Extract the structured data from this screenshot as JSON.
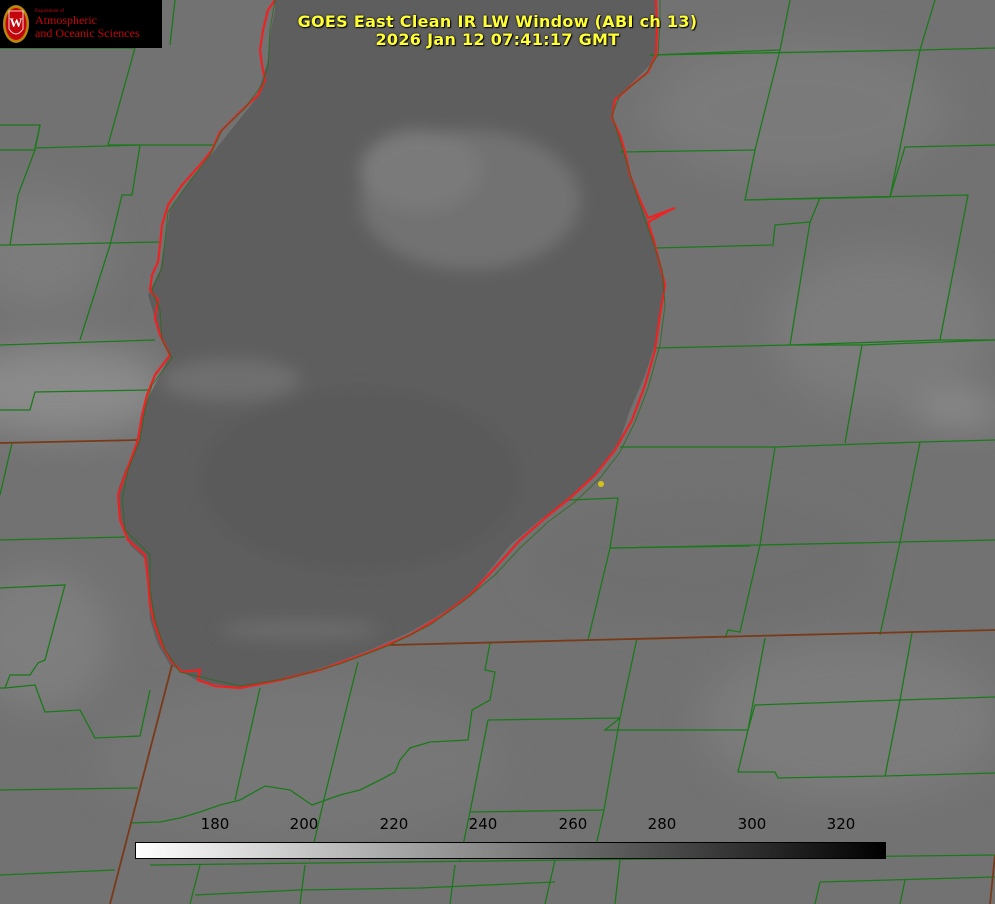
{
  "title": {
    "line1": "GOES East Clean IR LW Window (ABI ch 13)",
    "line2": "2026 Jan 12 07:41:17 GMT"
  },
  "logo": {
    "dept": "Department of",
    "line1": "Atmospheric",
    "line2": "and Oceanic Sciences",
    "seal_letter": "W"
  },
  "colorbar": {
    "min": 160,
    "max": 330,
    "ticks": [
      "180",
      "200",
      "220",
      "240",
      "260",
      "280",
      "300",
      "320"
    ],
    "colors": [
      "#ffffff",
      "#000000"
    ]
  },
  "colors": {
    "county_lines": "#1a7a1a",
    "coastline": "#ee2222",
    "title_text": "#ffff33",
    "marker": "#d4c21a"
  }
}
